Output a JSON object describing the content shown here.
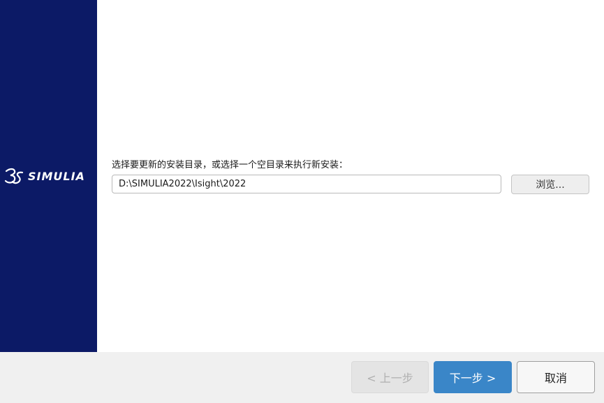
{
  "sidebar": {
    "logo_text": "SIMULIA",
    "logo_icon": "3ds-logo-icon",
    "background_color": "#0c1a66"
  },
  "content": {
    "prompt": "选择要更新的安装目录，或选择一个空目录来执行新安装：",
    "install_path": "D:\\SIMULIA2022\\Isight\\2022",
    "browse_label": "浏览..."
  },
  "footer": {
    "back_label": "< 上一步",
    "next_label": "下一步 >",
    "cancel_label": "取消",
    "accent_color": "#3a86c8"
  }
}
